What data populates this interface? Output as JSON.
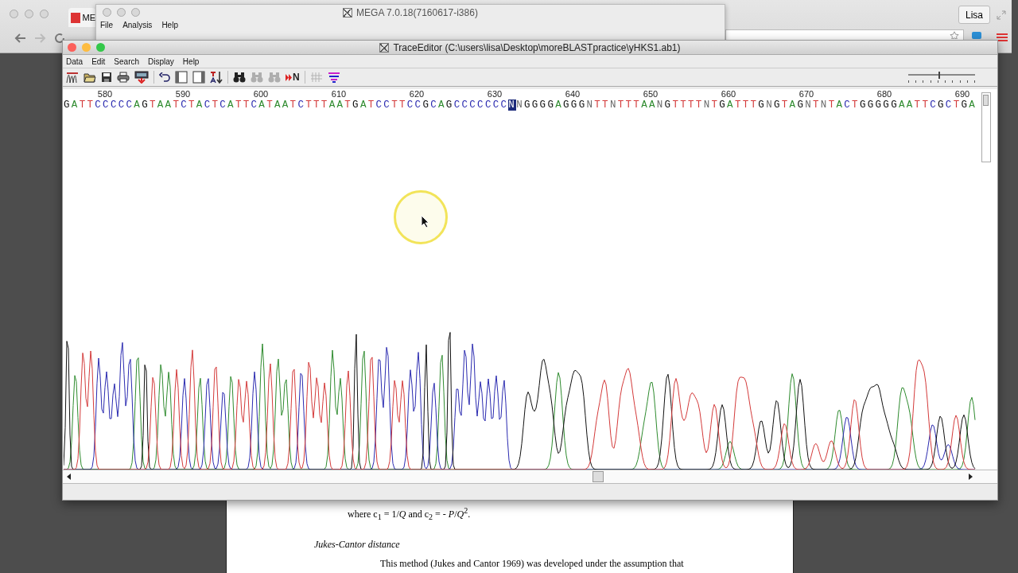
{
  "browser": {
    "tab": {
      "label": "ME"
    },
    "profile_button": "Lisa"
  },
  "mega_window": {
    "title": "MEGA 7.0.18(7160617-i386)",
    "menu": [
      "File",
      "Analysis",
      "Help"
    ]
  },
  "trace_editor": {
    "title": "TraceEditor (C:\\users\\lisa\\Desktop\\moreBLASTpractice\\yHKS1.ab1)",
    "menu": [
      "Data",
      "Edit",
      "Search",
      "Display",
      "Help"
    ],
    "toolbar": [
      {
        "kind": "dna",
        "disabled": false
      },
      {
        "kind": "open",
        "disabled": false
      },
      {
        "kind": "save",
        "disabled": false
      },
      {
        "kind": "print",
        "disabled": false
      },
      {
        "kind": "import",
        "disabled": false
      },
      {
        "kind": "separator"
      },
      {
        "kind": "undo",
        "disabled": false
      },
      {
        "kind": "panel-left",
        "disabled": false
      },
      {
        "kind": "panel-right",
        "disabled": false
      },
      {
        "kind": "sort",
        "disabled": false
      },
      {
        "kind": "separator"
      },
      {
        "kind": "find",
        "disabled": false
      },
      {
        "kind": "find-prev",
        "disabled": true
      },
      {
        "kind": "find-next",
        "disabled": true
      },
      {
        "kind": "next-n",
        "disabled": false,
        "label": "N"
      },
      {
        "kind": "separator"
      },
      {
        "kind": "grid",
        "disabled": true
      },
      {
        "kind": "lines",
        "disabled": false
      }
    ],
    "zoom": {
      "level": 0.45
    },
    "ruler": [
      "580",
      "590",
      "600",
      "610",
      "620",
      "630",
      "640",
      "650",
      "660",
      "670",
      "680",
      "690"
    ],
    "sequence": {
      "before": "GATTCCCCCAGTAATCTACTCATTCATAATCTTTAATGATCCTTCCGCAGCCCCCCC",
      "selected": "N",
      "after": "NGGGGAGGGNTTNTTTAANGTTTTNTGATTTGNGTAGNTNTACTGGGGGAATTCGCTGA"
    }
  },
  "document": {
    "lines": [
      {
        "kind": "formula",
        "text": "where c$_{1}$ = 1/*Q* and c$_{2}$ = - *P*/*Q*$^{2}$."
      },
      {
        "kind": "heading",
        "text": "Jukes-Cantor distance"
      },
      {
        "kind": "body",
        "text": "This method (Jukes and Cantor 1969) was developed under the assumption that"
      }
    ]
  }
}
